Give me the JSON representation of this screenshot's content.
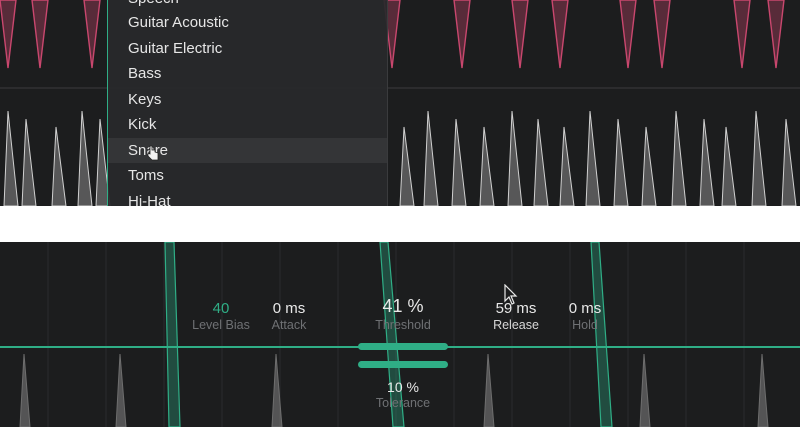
{
  "preset_menu": {
    "items": [
      {
        "label": "Speech"
      },
      {
        "label": "Guitar Acoustic"
      },
      {
        "label": "Guitar Electric"
      },
      {
        "label": "Bass"
      },
      {
        "label": "Keys"
      },
      {
        "label": "Kick"
      },
      {
        "label": "Snare"
      },
      {
        "label": "Toms"
      },
      {
        "label": "Hi-Hat"
      }
    ],
    "highlighted": "Snare"
  },
  "gate_params": {
    "level_bias": {
      "value": "40",
      "label": "Level Bias"
    },
    "attack": {
      "value": "0 ms",
      "label": "Attack"
    },
    "threshold": {
      "value": "41 %",
      "label": "Threshold"
    },
    "release": {
      "value": "59 ms",
      "label": "Release"
    },
    "hold": {
      "value": "0 ms",
      "label": "Hold"
    },
    "tolerance": {
      "value": "10 %",
      "label": "Tolerance"
    }
  },
  "colors": {
    "background": "#1c1d1e",
    "accent": "#2fae86",
    "upper_waveform": "#c9476e",
    "lower_waveform": "#8d8d8d"
  },
  "icons": [
    "mouse-pointer-icon",
    "threshold-handle-icon"
  ]
}
